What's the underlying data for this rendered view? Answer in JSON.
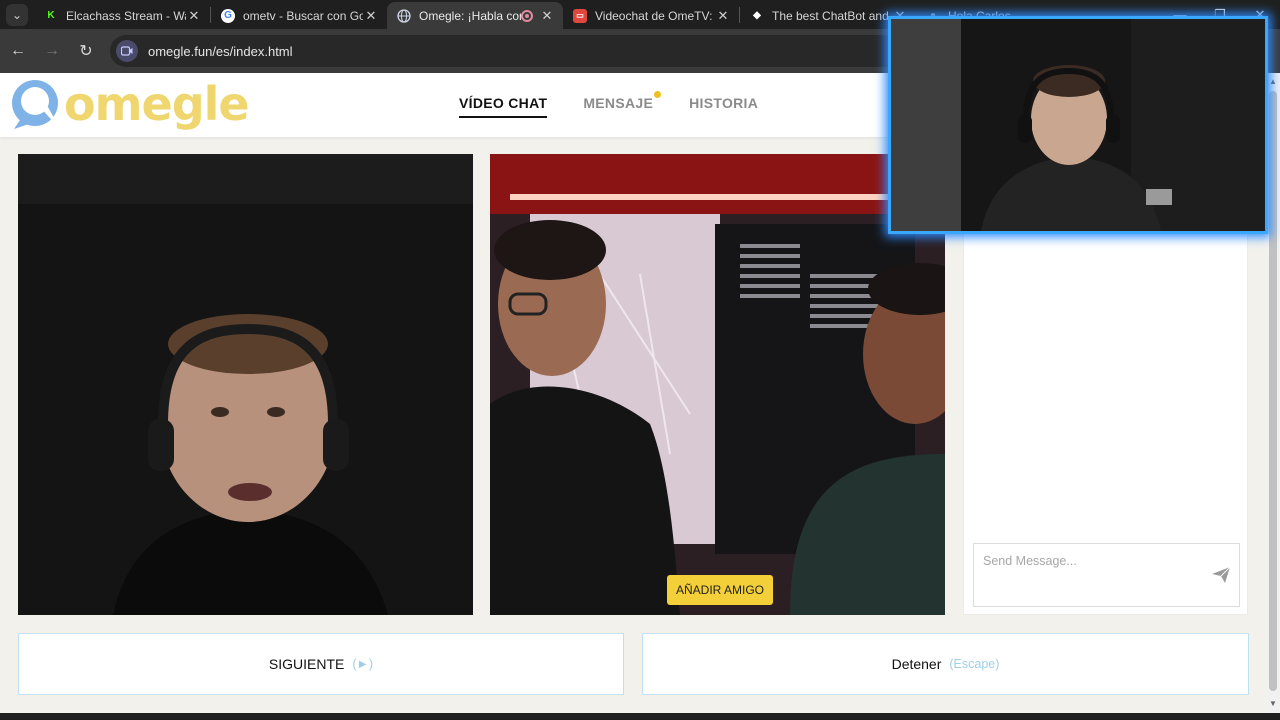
{
  "browser": {
    "tabs": [
      {
        "title": "Elcachass Stream - Wat",
        "favicon": "K",
        "favicon_color": "#53fc18",
        "active": false
      },
      {
        "title": "ometv - Buscar con Go",
        "favicon": "G",
        "favicon_color": "#4285f4",
        "active": false
      },
      {
        "title": "Omegle: ¡Habla con",
        "favicon": "globe",
        "favicon_color": "#8ab4f8",
        "active": true,
        "recording": true
      },
      {
        "title": "Videochat de OmeTV: u",
        "favicon": "tv",
        "favicon_color": "#e0483e",
        "active": false
      },
      {
        "title": "The best ChatBot and V",
        "favicon": "diamond",
        "favicon_color": "#ffffff",
        "active": false
      },
      {
        "title": "Hola Carlos",
        "favicon": "chat",
        "favicon_color": "#9aa0a6",
        "active": false
      }
    ],
    "url": "omegle.fun/es/index.html"
  },
  "site": {
    "logo_text": "omegle",
    "nav": [
      {
        "label": "VÍDEO CHAT",
        "active": true
      },
      {
        "label": "MENSAJE",
        "active": false,
        "notification": true
      },
      {
        "label": "HISTORIA",
        "active": false
      }
    ],
    "add_friend_label": "AÑADIR AMIGO",
    "message_placeholder": "Send Message...",
    "next_label": "SIGUIENTE",
    "next_hint": "(►)",
    "stop_label": "Detener",
    "stop_hint": "(Escape)"
  },
  "colors": {
    "logo_yellow": "#f0d66e",
    "logo_blue": "#7fb2e6",
    "add_friend_bg": "#f3cf3a",
    "button_border": "#bfe0ee",
    "hint_blue": "#9fcfe6",
    "overlay_glow": "#2d8cff"
  },
  "icons": {
    "back": "arrow-left-icon",
    "forward": "arrow-right-icon",
    "reload": "reload-icon",
    "send": "paper-plane-icon"
  }
}
